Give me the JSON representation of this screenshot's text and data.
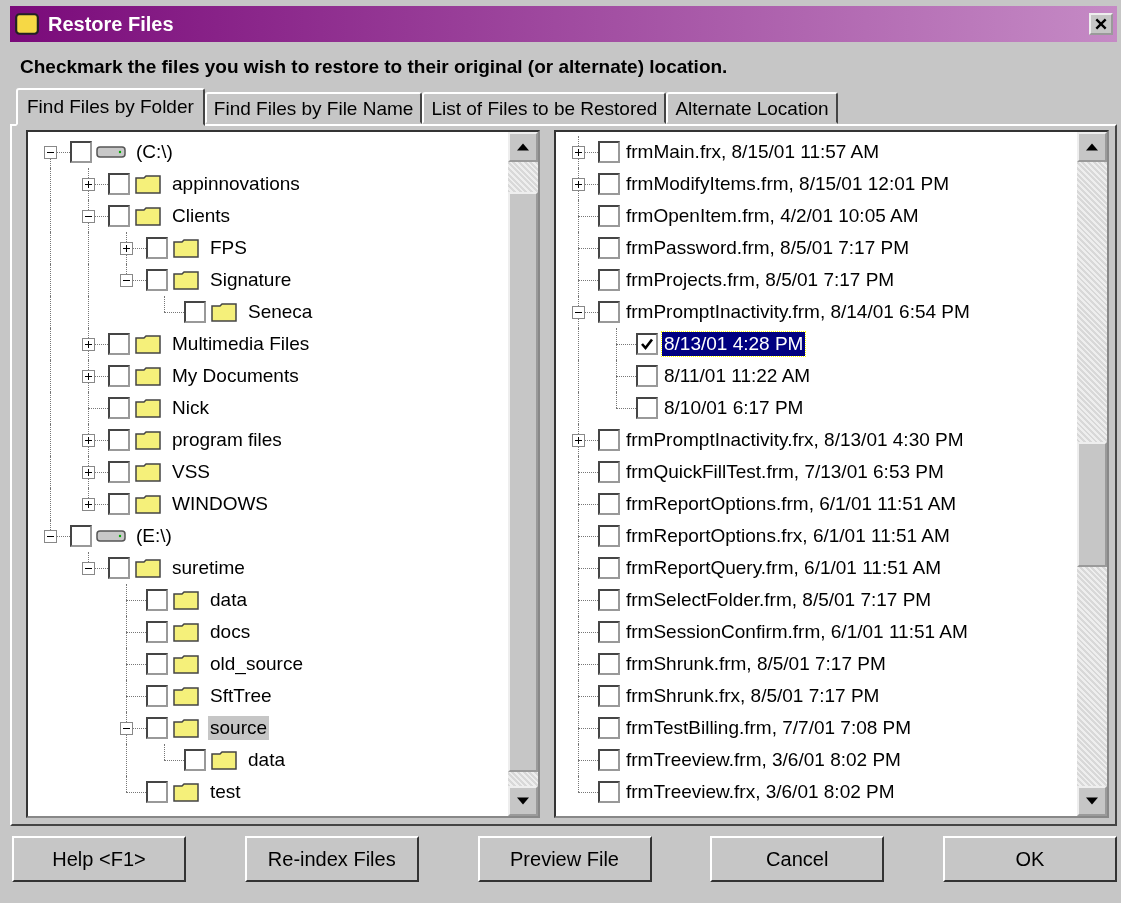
{
  "window": {
    "title": "Restore Files"
  },
  "instruction": "Checkmark the files you wish to restore to their original (or alternate) location.",
  "tabs": [
    {
      "label": "Find Files by Folder",
      "selected": true
    },
    {
      "label": "Find Files by File Name",
      "selected": false
    },
    {
      "label": "List of Files to be Restored",
      "selected": false
    },
    {
      "label": "Alternate Location",
      "selected": false
    }
  ],
  "folder_tree": [
    {
      "label": "(C:\\)",
      "kind": "drive",
      "expanded": true,
      "checked": false,
      "selected": false,
      "children": [
        {
          "label": "appinnovations",
          "kind": "folder",
          "expanded": false,
          "checked": false,
          "selected": false
        },
        {
          "label": "Clients",
          "kind": "folder",
          "expanded": true,
          "checked": false,
          "selected": false,
          "children": [
            {
              "label": "FPS",
              "kind": "folder",
              "expanded": false,
              "checked": false,
              "selected": false
            },
            {
              "label": "Signature",
              "kind": "folder",
              "expanded": true,
              "checked": false,
              "selected": false,
              "children": [
                {
                  "label": "Seneca",
                  "kind": "folder",
                  "checked": false,
                  "selected": false
                }
              ]
            }
          ]
        },
        {
          "label": "Multimedia Files",
          "kind": "folder",
          "expanded": false,
          "checked": false,
          "selected": false
        },
        {
          "label": "My Documents",
          "kind": "folder",
          "expanded": false,
          "checked": false,
          "selected": false
        },
        {
          "label": "Nick",
          "kind": "folder",
          "checked": false,
          "selected": false
        },
        {
          "label": "program files",
          "kind": "folder",
          "expanded": false,
          "checked": false,
          "selected": false
        },
        {
          "label": "VSS",
          "kind": "folder",
          "expanded": false,
          "checked": false,
          "selected": false
        },
        {
          "label": "WINDOWS",
          "kind": "folder",
          "expanded": false,
          "checked": false,
          "selected": false
        }
      ]
    },
    {
      "label": "(E:\\)",
      "kind": "drive",
      "expanded": true,
      "checked": false,
      "selected": false,
      "children": [
        {
          "label": "suretime",
          "kind": "folder",
          "expanded": true,
          "checked": false,
          "selected": false,
          "children": [
            {
              "label": "data",
              "kind": "folder",
              "checked": false,
              "selected": false
            },
            {
              "label": "docs",
              "kind": "folder",
              "checked": false,
              "selected": false
            },
            {
              "label": "old_source",
              "kind": "folder",
              "checked": false,
              "selected": false
            },
            {
              "label": "SftTree",
              "kind": "folder",
              "checked": false,
              "selected": false
            },
            {
              "label": "source",
              "kind": "folder",
              "expanded": true,
              "checked": false,
              "selected": true,
              "children": [
                {
                  "label": "data",
                  "kind": "folder",
                  "checked": false,
                  "selected": false
                }
              ]
            },
            {
              "label": "test",
              "kind": "folder",
              "checked": false,
              "selected": false
            }
          ]
        }
      ]
    }
  ],
  "file_tree": [
    {
      "label": "frmMain.frx, 8/15/01 11:57 AM",
      "expanded": false,
      "checked": false,
      "selected": false
    },
    {
      "label": "frmModifyItems.frm, 8/15/01 12:01 PM",
      "expanded": false,
      "checked": false,
      "selected": false
    },
    {
      "label": "frmOpenItem.frm, 4/2/01 10:05 AM",
      "checked": false,
      "selected": false
    },
    {
      "label": "frmPassword.frm, 8/5/01 7:17 PM",
      "checked": false,
      "selected": false
    },
    {
      "label": "frmProjects.frm, 8/5/01 7:17 PM",
      "checked": false,
      "selected": false
    },
    {
      "label": "frmPromptInactivity.frm, 8/14/01 6:54 PM",
      "expanded": true,
      "checked": false,
      "selected": false,
      "children": [
        {
          "label": "8/13/01 4:28 PM",
          "checked": true,
          "selected": true
        },
        {
          "label": "8/11/01 11:22 AM",
          "checked": false,
          "selected": false
        },
        {
          "label": "8/10/01 6:17 PM",
          "checked": false,
          "selected": false
        }
      ]
    },
    {
      "label": "frmPromptInactivity.frx, 8/13/01 4:30 PM",
      "expanded": false,
      "checked": false,
      "selected": false
    },
    {
      "label": "frmQuickFillTest.frm, 7/13/01 6:53 PM",
      "checked": false,
      "selected": false
    },
    {
      "label": "frmReportOptions.frm, 6/1/01 11:51 AM",
      "checked": false,
      "selected": false
    },
    {
      "label": "frmReportOptions.frx, 6/1/01 11:51 AM",
      "checked": false,
      "selected": false
    },
    {
      "label": "frmReportQuery.frm, 6/1/01 11:51 AM",
      "checked": false,
      "selected": false
    },
    {
      "label": "frmSelectFolder.frm, 8/5/01 7:17 PM",
      "checked": false,
      "selected": false
    },
    {
      "label": "frmSessionConfirm.frm, 6/1/01 11:51 AM",
      "checked": false,
      "selected": false
    },
    {
      "label": "frmShrunk.frm, 8/5/01 7:17 PM",
      "checked": false,
      "selected": false
    },
    {
      "label": "frmShrunk.frx, 8/5/01 7:17 PM",
      "checked": false,
      "selected": false
    },
    {
      "label": "frmTestBilling.frm, 7/7/01 7:08 PM",
      "checked": false,
      "selected": false
    },
    {
      "label": "frmTreeview.frm, 3/6/01 8:02 PM",
      "checked": false,
      "selected": false
    },
    {
      "label": "frmTreeview.frx, 3/6/01 8:02 PM",
      "checked": false,
      "selected": false
    }
  ],
  "buttons": [
    {
      "label": "Help <F1>"
    },
    {
      "label": "Re-index Files"
    },
    {
      "label": "Preview File"
    },
    {
      "label": "Cancel"
    },
    {
      "label": "OK"
    }
  ]
}
